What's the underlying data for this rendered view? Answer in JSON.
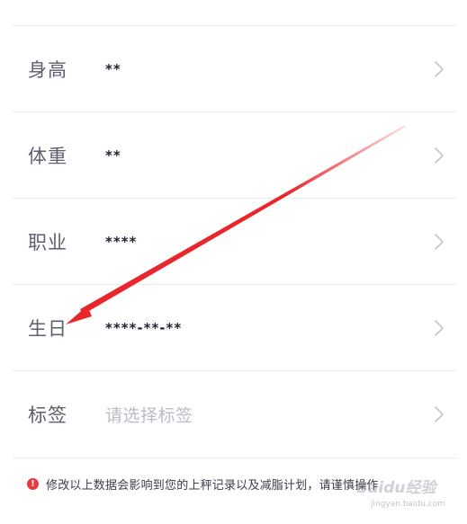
{
  "profile_fields": [
    {
      "label": "身高",
      "value": "**",
      "is_placeholder": false
    },
    {
      "label": "体重",
      "value": "**",
      "is_placeholder": false
    },
    {
      "label": "职业",
      "value": "****",
      "is_placeholder": false
    },
    {
      "label": "生日",
      "value": "****-**-**",
      "is_placeholder": false
    },
    {
      "label": "标签",
      "value": "请选择标签",
      "is_placeholder": true
    }
  ],
  "notice": {
    "icon": "exclamation-icon",
    "text": "修改以上数据会影响到您的上秤记录以及减脂计划，请谨慎操作"
  },
  "watermark": {
    "logo": "Baidu经验",
    "url": "jingyan.baidu.com"
  },
  "colors": {
    "label": "#5b5f6e",
    "value": "#1f2235",
    "placeholder": "#b9bcc6",
    "divider": "#ececef",
    "chevron": "#c4c6cf",
    "warning": "#e8383d",
    "annotation_arrow": "#e8262b"
  }
}
